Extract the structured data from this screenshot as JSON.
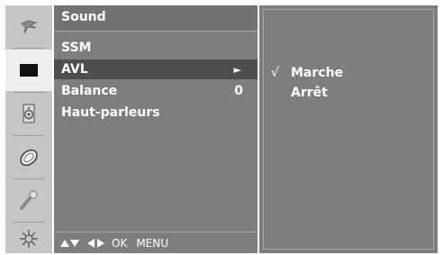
{
  "icons": [
    {
      "name": "picture-icon"
    },
    {
      "name": "sound-icon"
    },
    {
      "name": "time-icon"
    },
    {
      "name": "option-icon"
    },
    {
      "name": "lock-icon"
    },
    {
      "name": "setup-icon"
    }
  ],
  "menu": {
    "title": "Sound",
    "items": [
      {
        "label": "SSM",
        "value": ""
      },
      {
        "label": "AVL",
        "value": "►"
      },
      {
        "label": "Balance",
        "value": "0"
      },
      {
        "label": "Haut-parleurs",
        "value": ""
      }
    ],
    "selected_index": 1
  },
  "footer": {
    "ok": "OK",
    "menu": "MENU"
  },
  "submenu": {
    "check": "√",
    "options": [
      "Marche",
      "Arrêt"
    ],
    "checked_index": 0
  },
  "colors": {
    "panel": "#7e7e7e",
    "selected_row": "#4e4e4e",
    "icon_column": "#c6c6c6",
    "text": "#ffffff"
  }
}
